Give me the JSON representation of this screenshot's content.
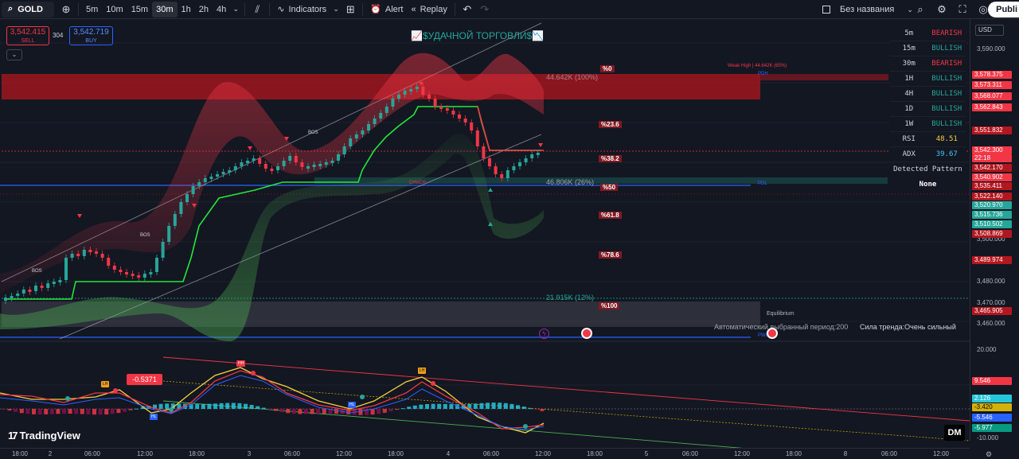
{
  "toolbar": {
    "symbol": "GOLD",
    "intervals": [
      "5m",
      "10m",
      "15m",
      "30m",
      "1h",
      "2h",
      "4h"
    ],
    "active_interval": "30m",
    "indicators_label": "Indicators",
    "alert_label": "Alert",
    "replay_label": "Replay",
    "layout_name": "Без названия",
    "publish_label": "Publi"
  },
  "quote": {
    "sell_price": "3,542.415",
    "sell_label": "SELL",
    "buy_price": "3,542.719",
    "buy_label": "BUY",
    "spread": "304"
  },
  "chart": {
    "banner": "📈$УДАЧНОЙ ТОРГОВЛИ$📉",
    "weak_high": "Weak High | 44.642K (65%)",
    "zone_top": "44.642K (100%)",
    "zone_mid": "46.806K (26%)",
    "zone_low": "21.915K (12%)",
    "equilibrium": "Equilibrium",
    "pdh": "PDH",
    "pdl": "PDL",
    "pwl": "PWL",
    "bos": "BOS",
    "fib_levels": [
      "%0",
      "%23.6",
      "%38.2",
      "%50",
      "%61.8",
      "%78.6",
      "%100"
    ],
    "auto_period": "Автоматический выбранный период:200",
    "trend_strength": "Сила тренда:Очень сильный",
    "osc_value": "-0.5371",
    "osc_markers": [
      "LH",
      "HL",
      "HH",
      "HL",
      "LH"
    ]
  },
  "status_table": {
    "rows": [
      {
        "tf": "5m",
        "state": "BEARISH",
        "color": "#f23645"
      },
      {
        "tf": "15m",
        "state": "BULLISH",
        "color": "#26a69a"
      },
      {
        "tf": "30m",
        "state": "BEARISH",
        "color": "#f23645"
      },
      {
        "tf": "1H",
        "state": "BULLISH",
        "color": "#26a69a"
      },
      {
        "tf": "4H",
        "state": "BULLISH",
        "color": "#26a69a"
      },
      {
        "tf": "1D",
        "state": "BULLISH",
        "color": "#26a69a"
      },
      {
        "tf": "1W",
        "state": "BULLISH",
        "color": "#26a69a"
      }
    ],
    "rsi_label": "RSI",
    "rsi_value": "48.51",
    "adx_label": "ADX",
    "adx_value": "39.67",
    "pattern_label": "Detected Pattern",
    "pattern_value": "None"
  },
  "price_axis": {
    "currency": "USD",
    "ticks": [
      "3,590.000",
      "3,500.000",
      "3,480.000",
      "3,470.000",
      "3,460.000",
      "20.000",
      "-10.000"
    ],
    "tags": [
      {
        "text": "3,578.375",
        "color": "#f23645"
      },
      {
        "text": "3,573.311",
        "color": "#f23645"
      },
      {
        "text": "3,568.077",
        "color": "#f23645"
      },
      {
        "text": "3,562.843",
        "color": "#f23645"
      },
      {
        "text": "3,551.832",
        "color": "#b2171f"
      },
      {
        "text": "3,542.300",
        "color": "#f23645"
      },
      {
        "text": "22:18",
        "color": "#f23645"
      },
      {
        "text": "3,542.170",
        "color": "#b2171f"
      },
      {
        "text": "3,540.902",
        "color": "#f23645"
      },
      {
        "text": "3,535.411",
        "color": "#b2171f"
      },
      {
        "text": "3,522.140",
        "color": "#b2171f"
      },
      {
        "text": "3,520.970",
        "color": "#26a69a"
      },
      {
        "text": "3,515.736",
        "color": "#26a69a"
      },
      {
        "text": "3,510.502",
        "color": "#26a69a"
      },
      {
        "text": "3,508.869",
        "color": "#b2171f"
      },
      {
        "text": "3,489.974",
        "color": "#b2171f"
      },
      {
        "text": "3,465.905",
        "color": "#b2171f"
      },
      {
        "text": "9.546",
        "color": "#f23645"
      },
      {
        "text": "2.126",
        "color": "#26c6da"
      },
      {
        "text": "-3.420",
        "color": "#d4b106"
      },
      {
        "text": "-5.546",
        "color": "#2962ff"
      },
      {
        "text": "-5.977",
        "color": "#089981"
      }
    ]
  },
  "time_axis": [
    "18:00",
    "2",
    "06:00",
    "12:00",
    "18:00",
    "3",
    "06:00",
    "12:00",
    "18:00",
    "4",
    "06:00",
    "12:00",
    "18:00",
    "5",
    "06:00",
    "12:00",
    "18:00",
    "8",
    "06:00",
    "12:00"
  ],
  "brand": "TradingView",
  "dm_badge": "DM"
}
